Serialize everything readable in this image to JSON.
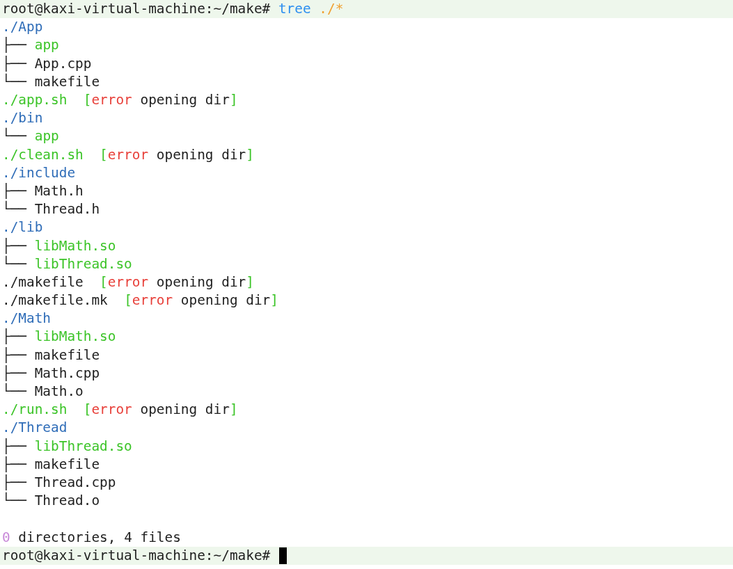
{
  "lines": [
    {
      "kind": "prompt",
      "cursor": false,
      "segments": [
        {
          "kind": "text",
          "text": "root@kaxi-virtual-machine:~/make# "
        },
        {
          "kind": "command",
          "text": "tree"
        },
        {
          "kind": "arg",
          "text": "./*"
        }
      ]
    },
    {
      "kind": "output",
      "segments": [
        {
          "kind": "dir",
          "text": "./App"
        }
      ]
    },
    {
      "kind": "output",
      "segments": [
        {
          "kind": "text",
          "text": "├── "
        },
        {
          "kind": "exec",
          "text": "app"
        }
      ]
    },
    {
      "kind": "output",
      "segments": [
        {
          "kind": "text",
          "text": "├── App.cpp"
        }
      ]
    },
    {
      "kind": "output",
      "segments": [
        {
          "kind": "text",
          "text": "└── makefile"
        }
      ]
    },
    {
      "kind": "output",
      "segments": [
        {
          "kind": "exec",
          "text": "./app.sh  ["
        },
        {
          "kind": "error",
          "text": "error"
        },
        {
          "kind": "text",
          "text": " opening dir"
        },
        {
          "kind": "exec",
          "text": "]"
        }
      ]
    },
    {
      "kind": "output",
      "segments": [
        {
          "kind": "dir",
          "text": "./bin"
        }
      ]
    },
    {
      "kind": "output",
      "segments": [
        {
          "kind": "text",
          "text": "└── "
        },
        {
          "kind": "exec",
          "text": "app"
        }
      ]
    },
    {
      "kind": "output",
      "segments": [
        {
          "kind": "exec",
          "text": "./clean.sh  ["
        },
        {
          "kind": "error",
          "text": "error"
        },
        {
          "kind": "text",
          "text": " opening dir"
        },
        {
          "kind": "exec",
          "text": "]"
        }
      ]
    },
    {
      "kind": "output",
      "segments": [
        {
          "kind": "dir",
          "text": "./include"
        }
      ]
    },
    {
      "kind": "output",
      "segments": [
        {
          "kind": "text",
          "text": "├── Math.h"
        }
      ]
    },
    {
      "kind": "output",
      "segments": [
        {
          "kind": "text",
          "text": "└── Thread.h"
        }
      ]
    },
    {
      "kind": "output",
      "segments": [
        {
          "kind": "dir",
          "text": "./lib"
        }
      ]
    },
    {
      "kind": "output",
      "segments": [
        {
          "kind": "text",
          "text": "├── "
        },
        {
          "kind": "exec",
          "text": "libMath.so"
        }
      ]
    },
    {
      "kind": "output",
      "segments": [
        {
          "kind": "text",
          "text": "└── "
        },
        {
          "kind": "exec",
          "text": "libThread.so"
        }
      ]
    },
    {
      "kind": "output",
      "segments": [
        {
          "kind": "text",
          "text": "./makefile  "
        },
        {
          "kind": "exec",
          "text": "["
        },
        {
          "kind": "error",
          "text": "error"
        },
        {
          "kind": "text",
          "text": " opening dir"
        },
        {
          "kind": "exec",
          "text": "]"
        }
      ]
    },
    {
      "kind": "output",
      "segments": [
        {
          "kind": "text",
          "text": "./makefile.mk  "
        },
        {
          "kind": "exec",
          "text": "["
        },
        {
          "kind": "error",
          "text": "error"
        },
        {
          "kind": "text",
          "text": " opening dir"
        },
        {
          "kind": "exec",
          "text": "]"
        }
      ]
    },
    {
      "kind": "output",
      "segments": [
        {
          "kind": "dir",
          "text": "./Math"
        }
      ]
    },
    {
      "kind": "output",
      "segments": [
        {
          "kind": "text",
          "text": "├── "
        },
        {
          "kind": "exec",
          "text": "libMath.so"
        }
      ]
    },
    {
      "kind": "output",
      "segments": [
        {
          "kind": "text",
          "text": "├── makefile"
        }
      ]
    },
    {
      "kind": "output",
      "segments": [
        {
          "kind": "text",
          "text": "├── Math.cpp"
        }
      ]
    },
    {
      "kind": "output",
      "segments": [
        {
          "kind": "text",
          "text": "└── Math.o"
        }
      ]
    },
    {
      "kind": "output",
      "segments": [
        {
          "kind": "exec",
          "text": "./run.sh  ["
        },
        {
          "kind": "error",
          "text": "error"
        },
        {
          "kind": "text",
          "text": " opening dir"
        },
        {
          "kind": "exec",
          "text": "]"
        }
      ]
    },
    {
      "kind": "output",
      "segments": [
        {
          "kind": "dir",
          "text": "./Thread"
        }
      ]
    },
    {
      "kind": "output",
      "segments": [
        {
          "kind": "text",
          "text": "├── "
        },
        {
          "kind": "exec",
          "text": "libThread.so"
        }
      ]
    },
    {
      "kind": "output",
      "segments": [
        {
          "kind": "text",
          "text": "├── makefile"
        }
      ]
    },
    {
      "kind": "output",
      "segments": [
        {
          "kind": "text",
          "text": "├── Thread.cpp"
        }
      ]
    },
    {
      "kind": "output",
      "segments": [
        {
          "kind": "text",
          "text": "└── Thread.o"
        }
      ]
    },
    {
      "kind": "summary",
      "segments": [
        {
          "kind": "count",
          "text": "0"
        },
        {
          "kind": "text",
          "text": " directories, 4 files"
        }
      ]
    },
    {
      "kind": "prompt",
      "cursor": true,
      "segments": [
        {
          "kind": "text",
          "text": "root@kaxi-virtual-machine:~/make# "
        }
      ]
    }
  ]
}
